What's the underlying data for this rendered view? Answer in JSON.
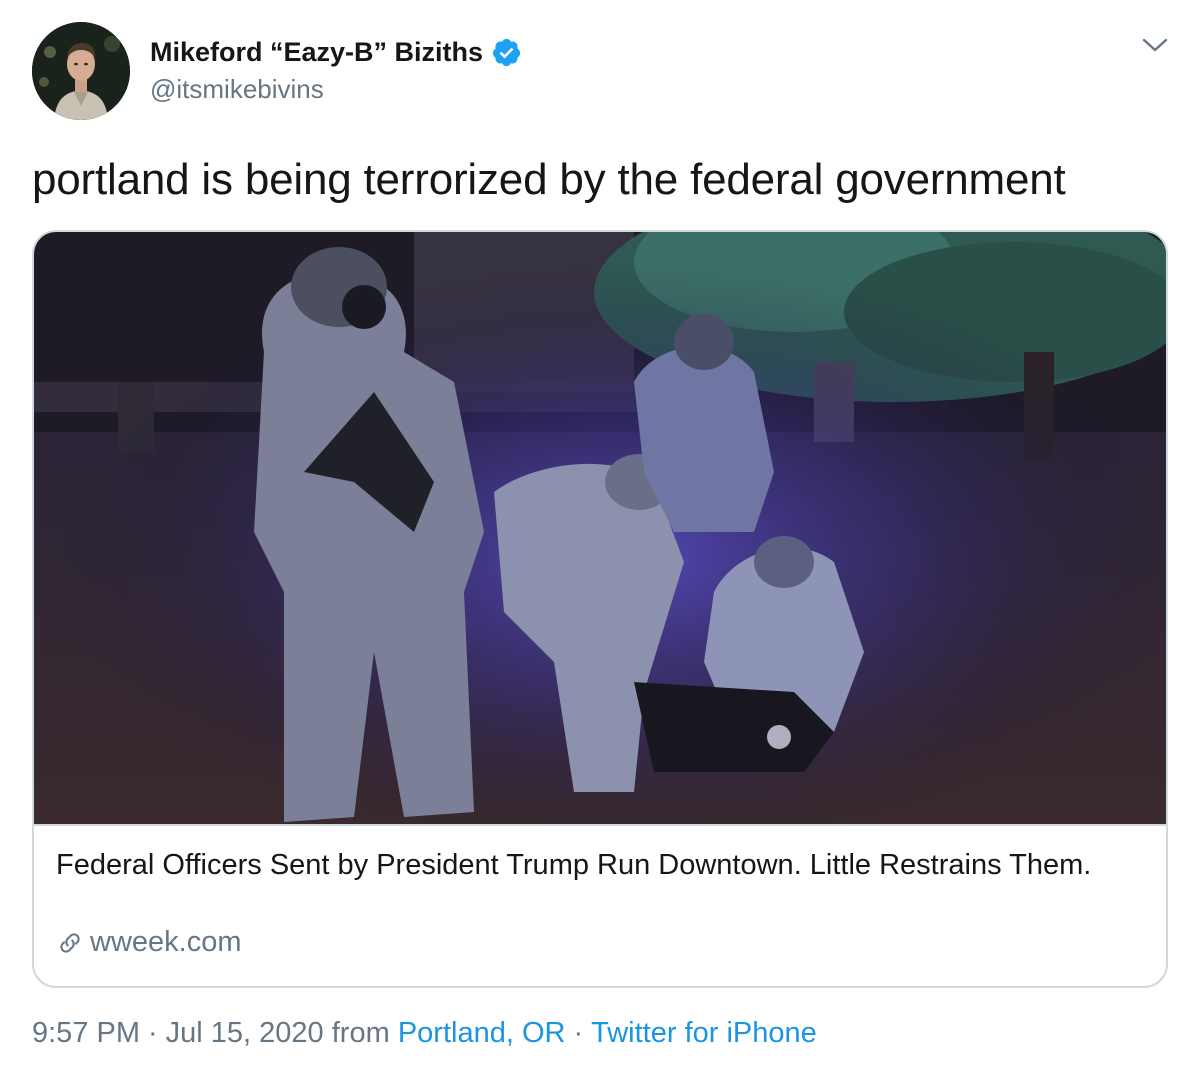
{
  "header": {
    "display_name": "Mikeford “Eazy-B” Biziths",
    "handle": "@itsmikebivins",
    "verified": true,
    "avatar_icon": "profile-photo",
    "menu_icon": "chevron-down-icon"
  },
  "tweet": {
    "text": "portland is being terrorized by the federal government"
  },
  "card": {
    "image_description_icon": "news-photo",
    "title": "Federal Officers Sent by President Trump Run Downtown. Little Restrains Them.",
    "domain": "wweek.com",
    "domain_icon": "link-icon"
  },
  "meta": {
    "time": "9:57 PM",
    "date": "Jul 15, 2020",
    "from_label": "from",
    "location": "Portland, OR",
    "source": "Twitter for iPhone"
  },
  "colors": {
    "text_primary": "#14171a",
    "text_secondary": "#657786",
    "link": "#1b95e0",
    "verified_badge": "#1da1f2",
    "card_border": "#cfd9de"
  }
}
